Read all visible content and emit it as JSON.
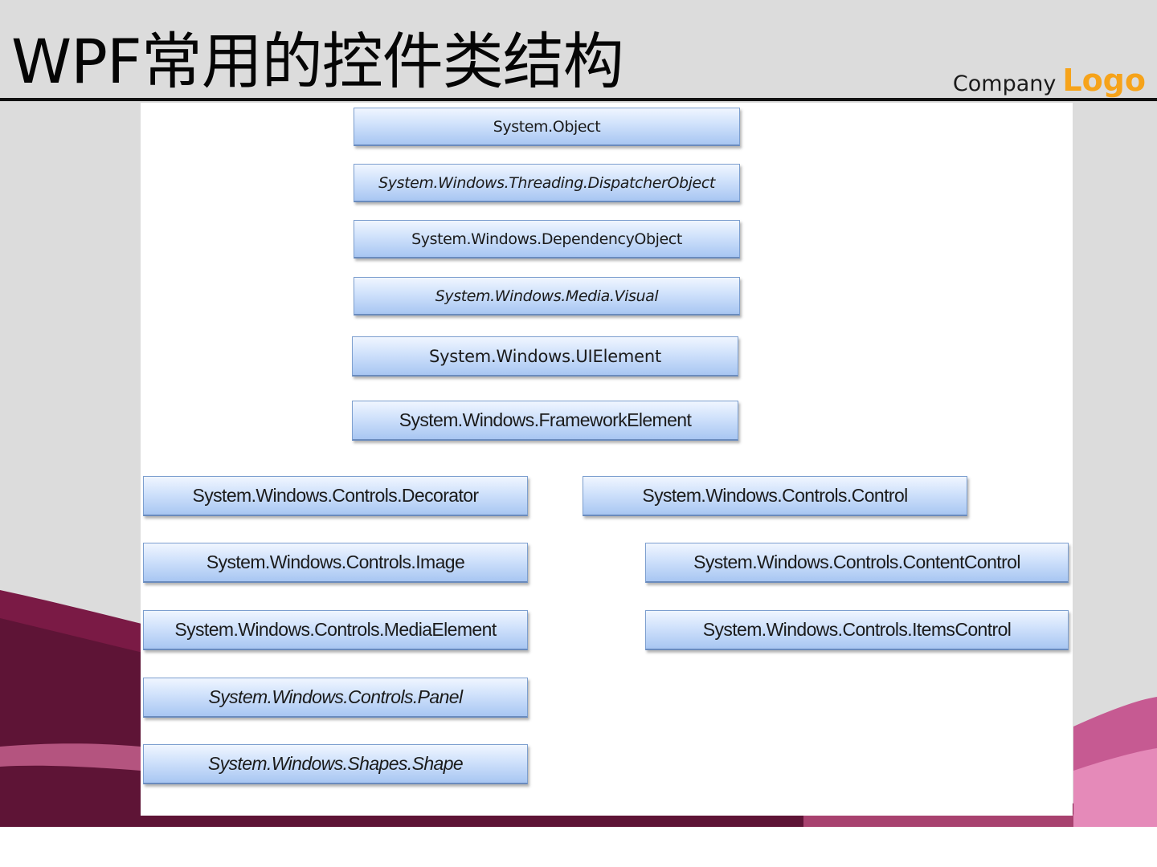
{
  "slide": {
    "title": "WPF常用的控件类结构",
    "logo": {
      "company": "Company",
      "mark": "Logo"
    }
  },
  "nodes": {
    "object": "System.Object",
    "dispatcher_object": "System.Windows.Threading.DispatcherObject",
    "dependency_object": "System.Windows.DependencyObject",
    "visual": "System.Windows.Media.Visual",
    "ui_element": "System.Windows.UIElement",
    "framework_element": "System.Windows.FrameworkElement",
    "decorator": "System.Windows.Controls.Decorator",
    "image": "System.Windows.Controls.Image",
    "media_element": "System.Windows.Controls.MediaElement",
    "panel": "System.Windows.Controls.Panel",
    "shape": "System.Windows.Shapes.Shape",
    "control": "System.Windows.Controls.Control",
    "content_control": "System.Windows.Controls.ContentControl",
    "items_control": "System.Windows.Controls.ItemsControl"
  }
}
